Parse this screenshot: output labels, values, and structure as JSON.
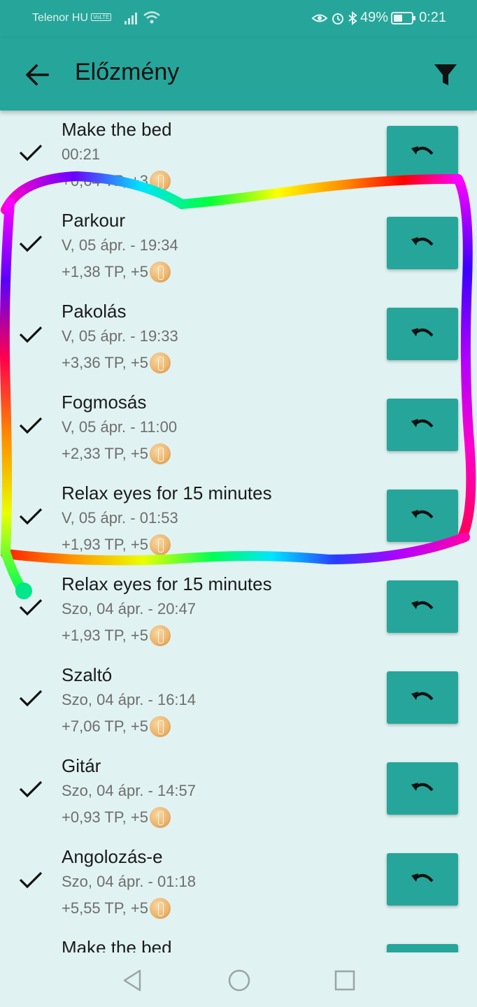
{
  "status_bar": {
    "carrier": "Telenor HU",
    "volte": "VoLTE",
    "battery": "49%",
    "time": "0:21"
  },
  "app_bar": {
    "title": "Előzmény"
  },
  "history": [
    {
      "name": "Make the bed",
      "date": "00:21",
      "reward": "+0,64 TP, +3"
    },
    {
      "name": "Parkour",
      "date": "V, 05 ápr. - 19:34",
      "reward": "+1,38 TP, +5"
    },
    {
      "name": "Pakolás",
      "date": "V, 05 ápr. - 19:33",
      "reward": "+3,36 TP, +5"
    },
    {
      "name": "Fogmosás",
      "date": "V, 05 ápr. - 11:00",
      "reward": "+2,33 TP, +5"
    },
    {
      "name": "Relax eyes for 15 minutes",
      "date": "V, 05 ápr. - 01:53",
      "reward": "+1,93 TP, +5"
    },
    {
      "name": "Relax eyes for 15 minutes",
      "date": "Szo, 04 ápr. - 20:47",
      "reward": "+1,93 TP, +5"
    },
    {
      "name": "Szaltó",
      "date": "Szo, 04 ápr. - 16:14",
      "reward": "+7,06 TP, +5"
    },
    {
      "name": "Gitár",
      "date": "Szo, 04 ápr. - 14:57",
      "reward": "+0,93 TP, +5"
    },
    {
      "name": "Angolozás-e",
      "date": "Szo, 04 ápr. - 01:18",
      "reward": "+5,55 TP, +5"
    },
    {
      "name": "Make the bed",
      "date": "",
      "reward": ""
    }
  ],
  "colors": {
    "primary": "#26a69a",
    "background": "#e1f2f2"
  }
}
